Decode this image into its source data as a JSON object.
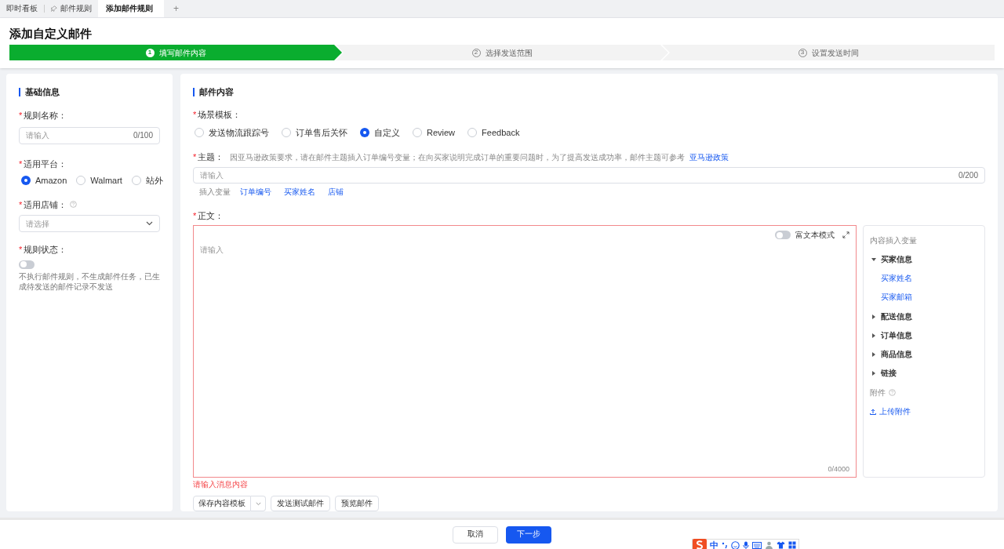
{
  "tabs": [
    {
      "label": "即时看板",
      "selected": false,
      "pinned": false
    },
    {
      "label": "邮件规则",
      "selected": false,
      "pinned": true
    },
    {
      "label": "添加邮件规则",
      "selected": true,
      "pinned": false
    }
  ],
  "new_tab": "+",
  "page_title": "添加自定义邮件",
  "steps": [
    {
      "number": "1",
      "label": "填写邮件内容",
      "selected": true
    },
    {
      "number": "2",
      "label": "选择发送范围",
      "selected": false
    },
    {
      "number": "3",
      "label": "设置发送时间",
      "selected": false
    }
  ],
  "basic_info": {
    "title": "基础信息",
    "rule_name": {
      "required_mark": "*",
      "label": "规则名称：",
      "placeholder": "请输入",
      "count": "0/100"
    },
    "platform": {
      "required_mark": "*",
      "label": "适用平台：",
      "options": [
        {
          "label": "Amazon",
          "selected": true
        },
        {
          "label": "Walmart",
          "selected": false
        },
        {
          "label": "站外",
          "selected": false
        }
      ]
    },
    "store": {
      "required_mark": "*",
      "label": "适用店铺：",
      "placeholder": "请选择"
    },
    "status": {
      "required_mark": "*",
      "label": "规则状态：",
      "on": false,
      "hint": "不执行邮件规则，不生成邮件任务，已生成待发送的邮件记录不发送"
    }
  },
  "mail_content": {
    "title": "邮件内容",
    "scene": {
      "required_mark": "*",
      "label": "场景模板：",
      "options": [
        {
          "label": "发送物流跟踪号",
          "selected": false
        },
        {
          "label": "订单售后关怀",
          "selected": false
        },
        {
          "label": "自定义",
          "selected": true
        },
        {
          "label": "Review",
          "selected": false
        },
        {
          "label": "Feedback",
          "selected": false
        }
      ]
    },
    "subject": {
      "required_mark": "*",
      "label": "主题：",
      "note": "因亚马逊政策要求，请在邮件主题插入订单编号变量；在向买家说明完成订单的重要问题时，为了提高发送成功率，邮件主题可参考",
      "link": "亚马逊政策",
      "placeholder": "请输入",
      "count": "0/200"
    },
    "insert_label": "插入变量",
    "insert_vars": [
      "订单编号",
      "买家姓名",
      "店铺"
    ],
    "body": {
      "required_mark": "*",
      "label": "正文：",
      "placeholder": "请输入",
      "rich_mode_label": "富文本模式",
      "rich_mode": false,
      "count": "0/4000",
      "error": "请输入消息内容"
    },
    "variables": {
      "title": "内容插入变量",
      "groups": [
        {
          "label": "买家信息",
          "expanded": true,
          "children": [
            {
              "label": "买家姓名"
            },
            {
              "label": "买家邮箱"
            }
          ]
        },
        {
          "label": "配送信息",
          "expanded": false
        },
        {
          "label": "订单信息",
          "expanded": false
        },
        {
          "label": "商品信息",
          "expanded": false
        },
        {
          "label": "链接",
          "expanded": false
        }
      ],
      "attachment_label": "附件",
      "upload": "上传附件"
    },
    "buttons": [
      "保存内容模板",
      "发送测试邮件",
      "预览邮件"
    ]
  },
  "footer": {
    "cancel": "取消",
    "next": "下一步"
  },
  "ime_toolbar": {
    "mode": "中"
  }
}
